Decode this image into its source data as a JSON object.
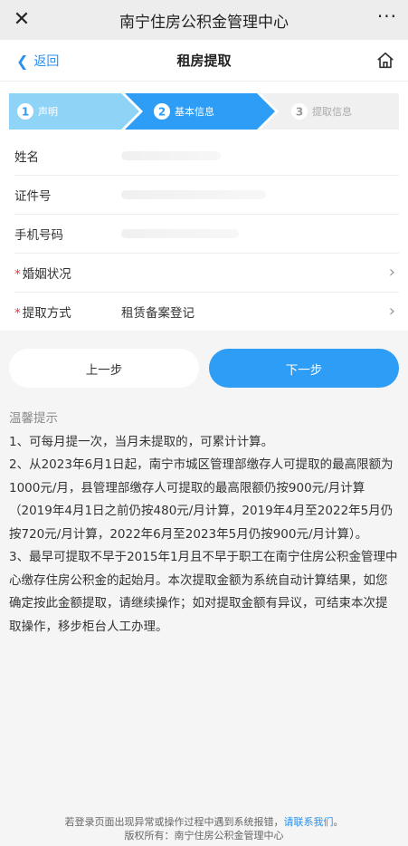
{
  "topbar": {
    "close_glyph": "✕",
    "title": "南宁住房公积金管理中心",
    "more_glyph": "···"
  },
  "navbar": {
    "back_label": "返回",
    "title": "租房提取",
    "home_icon": "home-icon"
  },
  "steps": [
    {
      "num": "1",
      "label": "声明",
      "state": "done"
    },
    {
      "num": "2",
      "label": "基本信息",
      "state": "current"
    },
    {
      "num": "3",
      "label": "提取信息",
      "state": "pending"
    }
  ],
  "form": {
    "rows": [
      {
        "label": "姓名",
        "required": false,
        "value": ""
      },
      {
        "label": "证件号",
        "required": false,
        "value": ""
      },
      {
        "label": "手机号码",
        "required": false,
        "value": ""
      },
      {
        "label": "婚姻状况",
        "required": true,
        "value": ""
      },
      {
        "label": "提取方式",
        "required": true,
        "value": "租赁备案登记"
      }
    ]
  },
  "buttons": {
    "prev": "上一步",
    "next": "下一步"
  },
  "tips": {
    "heading": "温馨提示",
    "items": [
      "1、可每月提一次，当月未提取的，可累计计算。",
      "2、从2023年6月1日起，南宁市城区管理部缴存人可提取的最高限额为1000元/月，县管理部缴存人可提取的最高限额仍按900元/月计算（2019年4月1日之前仍按480元/月计算，2019年4月至2022年5月仍按720元/月计算，2022年6月至2023年5月仍按900元/月计算）。",
      "3、最早可提取不早于2015年1月且不早于职工在南宁住房公积金管理中心缴存住房公积金的起始月。本次提取金额为系统自动计算结果，如您确定按此金额提取，请继续操作；如对提取金额有异议，可结束本次提取操作，移步柜台人工办理。"
    ]
  },
  "footer": {
    "line1_prefix": "若登录页面出现异常或操作过程中遇到系统报错，",
    "link": "请联系我们",
    "line1_suffix": "。",
    "line2": "版权所有：南宁住房公积金管理中心"
  },
  "colors": {
    "accent": "#2e9df5",
    "step_done": "#8fd3f7",
    "step_pending": "#f0f0f0",
    "required": "#e33333"
  }
}
